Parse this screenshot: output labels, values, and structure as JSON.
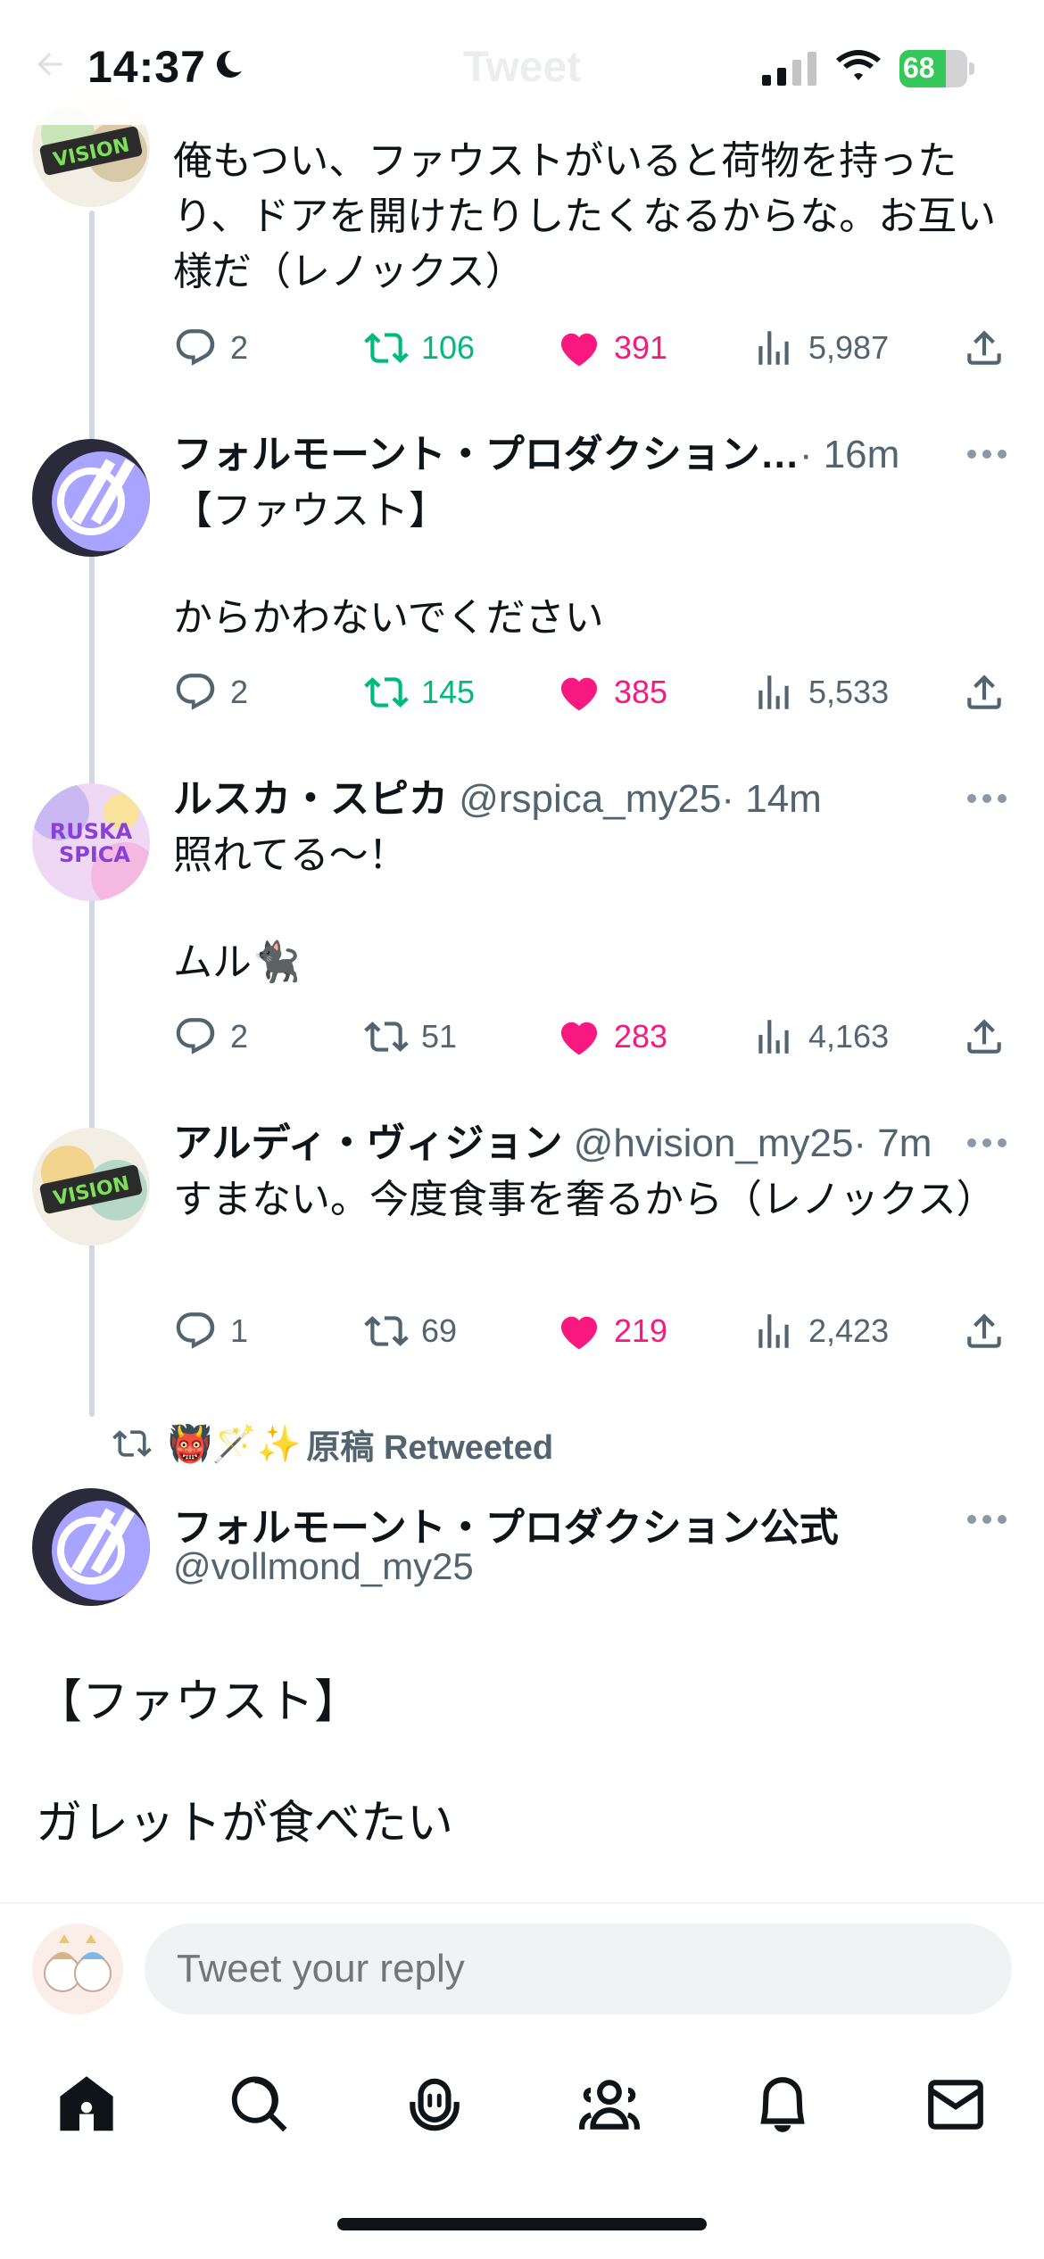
{
  "status_bar": {
    "time": "14:37",
    "battery": "68"
  },
  "header": {
    "title": "Tweet"
  },
  "tweets": [
    {
      "text": "俺もつい、ファウストがいると荷物を持ったり、ドアを開けたりしたくなるからな。お互い様だ（レノックス）",
      "replies": "2",
      "retweets": "106",
      "likes": "391",
      "views": "5,987",
      "retweeted": true,
      "liked": true
    },
    {
      "name": "フォルモーント・プロダクション…",
      "time": "· 16m",
      "text_line1": "【ファウスト】",
      "text_line2": "からかわないでください",
      "replies": "2",
      "retweets": "145",
      "likes": "385",
      "views": "5,533",
      "retweeted": true,
      "liked": true
    },
    {
      "name": "ルスカ・スピカ",
      "handle": "@rspica_my25",
      "time": "· 14m",
      "text_line1": "照れてる～！",
      "text_line2": "ムル🐈‍⬛",
      "replies": "2",
      "retweets": "51",
      "likes": "283",
      "views": "4,163",
      "retweeted": false,
      "liked": true
    },
    {
      "name": "アルディ・ヴィジョン",
      "handle": "@hvision_my25",
      "time": "· 7m",
      "text": "すまない。今度食事を奢るから（レノックス）",
      "replies": "1",
      "retweets": "69",
      "likes": "219",
      "views": "2,423",
      "retweeted": false,
      "liked": true
    }
  ],
  "retweet_banner": {
    "emoji": "👹🪄✨",
    "text": "原稿 Retweeted"
  },
  "main_tweet": {
    "name": "フォルモーント・プロダクション公式",
    "handle": "@vollmond_my25",
    "line1": "【ファウスト】",
    "line2": "ガレットが食べたい"
  },
  "reply_bar": {
    "placeholder": "Tweet your reply"
  },
  "tab_bar": [
    "home-icon",
    "search-icon",
    "spaces-icon",
    "communities-icon",
    "notifications-icon",
    "messages-icon"
  ],
  "colors": {
    "retweet": "#00ba7c",
    "like": "#f91880",
    "muted": "#536471",
    "thread": "#cfd9de"
  }
}
